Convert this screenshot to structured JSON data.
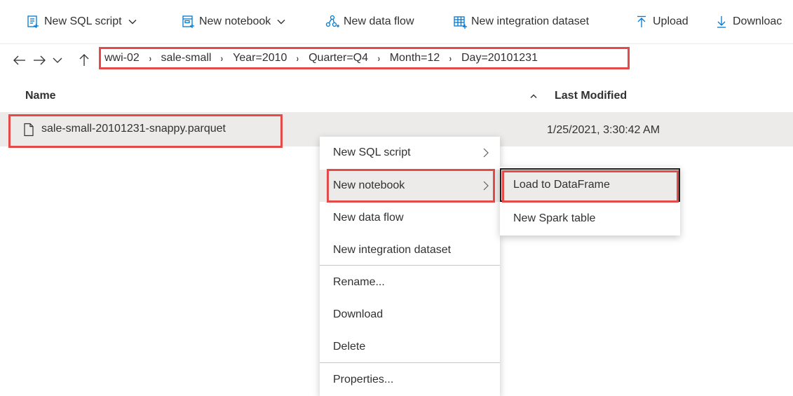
{
  "toolbar": {
    "items": [
      {
        "label": "New SQL script",
        "icon": "sql-script-icon",
        "has_chevron": true
      },
      {
        "label": "New notebook",
        "icon": "notebook-icon",
        "has_chevron": true
      },
      {
        "label": "New data flow",
        "icon": "data-flow-icon",
        "has_chevron": false
      },
      {
        "label": "New integration dataset",
        "icon": "dataset-table-icon",
        "has_chevron": false
      },
      {
        "label": "Upload",
        "icon": "upload-arrow-icon",
        "has_chevron": false
      },
      {
        "label": "Downloac",
        "icon": "download-arrow-icon",
        "has_chevron": false
      }
    ]
  },
  "nav": {
    "icons": [
      "back-arrow-icon",
      "forward-arrow-icon",
      "recent-chevron-icon",
      "up-arrow-icon"
    ]
  },
  "breadcrumb": {
    "items": [
      "wwi-02",
      "sale-small",
      "Year=2010",
      "Quarter=Q4",
      "Month=12",
      "Day=20101231"
    ],
    "separator": "›"
  },
  "table": {
    "columns": {
      "name": "Name",
      "modified": "Last Modified"
    },
    "sort": "ascending",
    "rows": [
      {
        "name": "sale-small-20101231-snappy.parquet",
        "modified": "1/25/2021, 3:30:42 AM",
        "icon": "file-icon"
      }
    ]
  },
  "context_menu": {
    "items": [
      {
        "label": "New SQL script",
        "has_submenu": true
      },
      {
        "label": "New notebook",
        "has_submenu": true,
        "active": true
      },
      {
        "label": "New data flow",
        "has_submenu": false
      },
      {
        "label": "New integration dataset",
        "has_submenu": false
      },
      {
        "label": "Rename...",
        "has_submenu": false
      },
      {
        "label": "Download",
        "has_submenu": false
      },
      {
        "label": "Delete",
        "has_submenu": false
      },
      {
        "label": "Properties...",
        "has_submenu": false
      }
    ]
  },
  "submenu": {
    "items": [
      {
        "label": "Load to DataFrame",
        "active": true
      },
      {
        "label": "New Spark table",
        "active": false
      }
    ]
  },
  "colors": {
    "accent": "#0078d4",
    "highlight_border": "#e34b4b",
    "row_selected": "#edebe9",
    "text": "#323130"
  }
}
